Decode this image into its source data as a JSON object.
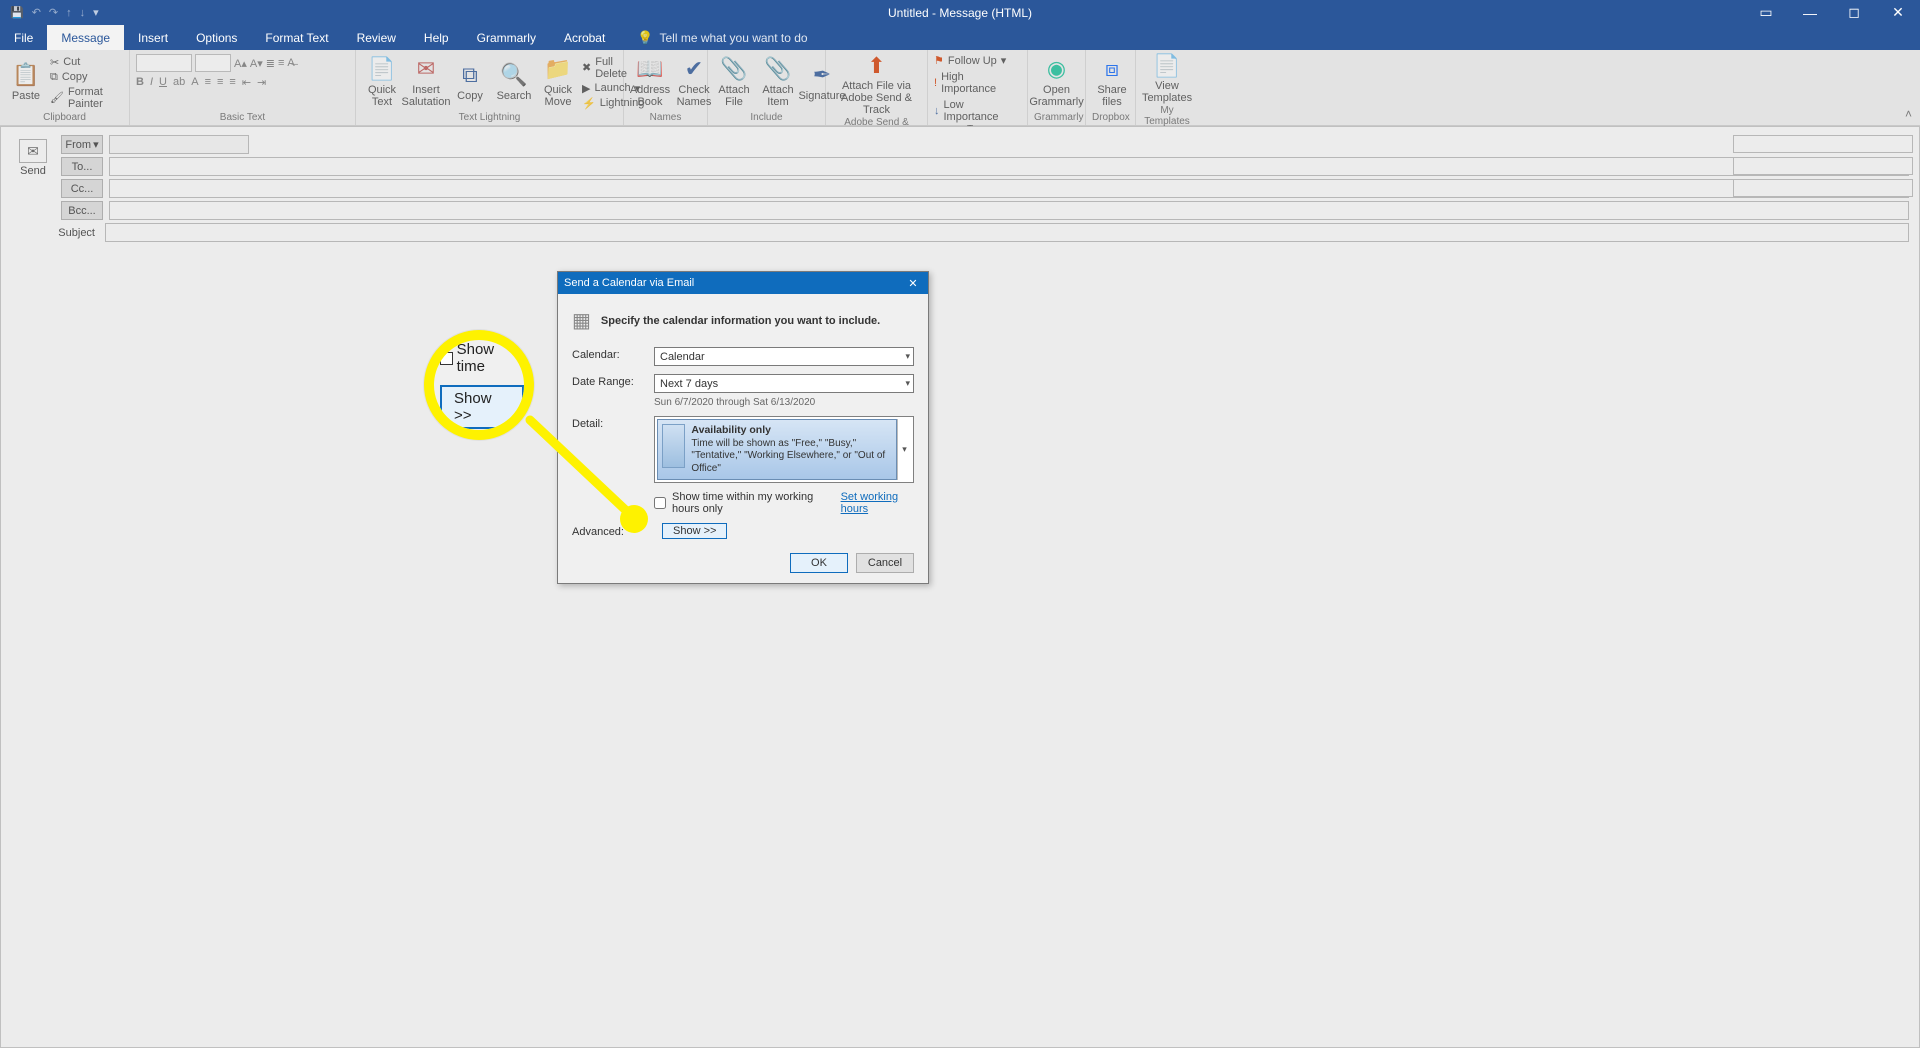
{
  "titlebar": {
    "title": "Untitled - Message (HTML)"
  },
  "tabs": {
    "file": "File",
    "message": "Message",
    "insert": "Insert",
    "options": "Options",
    "formattext": "Format Text",
    "review": "Review",
    "help": "Help",
    "grammarly": "Grammarly",
    "acrobat": "Acrobat",
    "tellme": "Tell me what you want to do"
  },
  "ribbon": {
    "clipboard": {
      "paste": "Paste",
      "cut": "Cut",
      "copy": "Copy",
      "fmt": "Format Painter",
      "label": "Clipboard"
    },
    "basictext": {
      "label": "Basic Text"
    },
    "textlightning": {
      "quicktext": "Quick\nText",
      "salutation": "Insert\nSalutation",
      "copy": "Copy",
      "search": "Search",
      "quickmove": "Quick\nMove",
      "fulldelete": "Full Delete",
      "launch": "Launch",
      "lightning": "Lightning",
      "label": "Text Lightning"
    },
    "names": {
      "addrbook": "Address\nBook",
      "check": "Check\nNames",
      "label": "Names"
    },
    "include": {
      "attachfile": "Attach\nFile",
      "attachitem": "Attach\nItem",
      "signature": "Signature",
      "label": "Include"
    },
    "adobe": {
      "sendtrack": "Attach File via\nAdobe Send & Track",
      "label": "Adobe Send & Track"
    },
    "tags": {
      "followup": "Follow Up",
      "high": "High Importance",
      "low": "Low Importance",
      "label": "Tags"
    },
    "grammarly": {
      "open": "Open\nGrammarly",
      "label": "Grammarly"
    },
    "dropbox": {
      "share": "Share\nfiles",
      "label": "Dropbox"
    },
    "templates": {
      "view": "View\nTemplates",
      "label": "My Templates"
    }
  },
  "compose": {
    "send": "Send",
    "from": "From",
    "to": "To...",
    "cc": "Cc...",
    "bcc": "Bcc...",
    "subject": "Subject"
  },
  "dialog": {
    "title": "Send a Calendar via Email",
    "instruction": "Specify the calendar information you want to include.",
    "calendar_lbl": "Calendar:",
    "calendar_val": "Calendar",
    "daterange_lbl": "Date Range:",
    "daterange_val": "Next 7 days",
    "daterange_note": "Sun 6/7/2020 through Sat 6/13/2020",
    "detail_lbl": "Detail:",
    "detail_title": "Availability only",
    "detail_desc": "Time will be shown as \"Free,\" \"Busy,\" \"Tentative,\" \"Working Elsewhere,\" or \"Out of Office\"",
    "workhours_chk": "Show time within my working hours only",
    "setworkhours": "Set working hours",
    "advanced_lbl": "Advanced:",
    "show": "Show >>",
    "ok": "OK",
    "cancel": "Cancel"
  },
  "magnifier": {
    "row1": "Show time",
    "btn": "Show >>"
  }
}
